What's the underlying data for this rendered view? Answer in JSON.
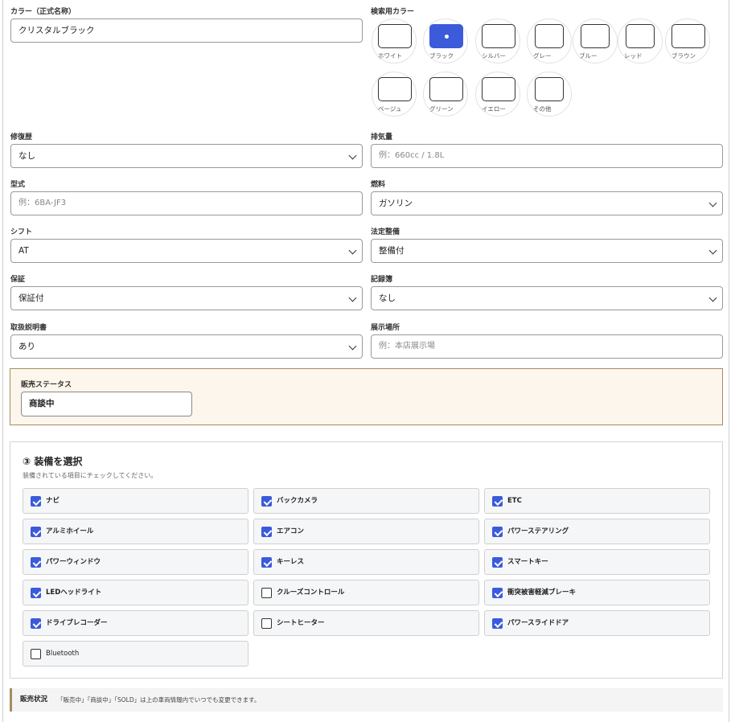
{
  "color_official": {
    "label": "カラー（正式名称）",
    "value": "クリスタルブラック"
  },
  "search_color": {
    "label": "検索用カラー",
    "options": [
      {
        "name": "ホワイト",
        "selected": false
      },
      {
        "name": "ブラック",
        "selected": true
      },
      {
        "name": "シルバー",
        "selected": false
      },
      {
        "name": "グレー",
        "selected": false
      },
      {
        "name": "ブルー",
        "selected": false
      },
      {
        "name": "レッド",
        "selected": false
      },
      {
        "name": "ブラウン",
        "selected": false
      },
      {
        "name": "ベージュ",
        "selected": false
      },
      {
        "name": "グリーン",
        "selected": false
      },
      {
        "name": "イエロー",
        "selected": false
      },
      {
        "name": "その他",
        "selected": false
      }
    ],
    "accent_color": "#3b5bdb"
  },
  "fields": {
    "repair_history": {
      "label": "修復歴",
      "value": "なし"
    },
    "displacement": {
      "label": "排気量",
      "placeholder": "例：660cc / 1.8L"
    },
    "model_code": {
      "label": "型式",
      "placeholder": "例：6BA-JF3"
    },
    "fuel": {
      "label": "燃料",
      "value": "ガソリン"
    },
    "shift": {
      "label": "シフト",
      "value": "AT"
    },
    "inspection": {
      "label": "法定整備",
      "value": "整備付"
    },
    "warranty": {
      "label": "保証",
      "value": "保証付"
    },
    "record_book": {
      "label": "記録簿",
      "value": "なし"
    },
    "manual": {
      "label": "取扱説明書",
      "value": "あり"
    },
    "showroom": {
      "label": "展示場所",
      "placeholder": "例：本店展示場"
    }
  },
  "sales_status": {
    "label": "販売ステータス",
    "value": "商談中",
    "panel_color": "#fdf6ec"
  },
  "equipment": {
    "title": "③ 装備を選択",
    "subtitle": "装備されている項目にチェックしてください。",
    "items": [
      {
        "label": "ナビ",
        "checked": true
      },
      {
        "label": "バックカメラ",
        "checked": true
      },
      {
        "label": "ETC",
        "checked": true
      },
      {
        "label": "アルミホイール",
        "checked": true
      },
      {
        "label": "エアコン",
        "checked": true
      },
      {
        "label": "パワーステアリング",
        "checked": true
      },
      {
        "label": "パワーウィンドウ",
        "checked": true
      },
      {
        "label": "キーレス",
        "checked": true
      },
      {
        "label": "スマートキー",
        "checked": true
      },
      {
        "label": "LEDヘッドライト",
        "checked": true
      },
      {
        "label": "クルーズコントロール",
        "checked": false
      },
      {
        "label": "衝突被害軽減ブレーキ",
        "checked": true
      },
      {
        "label": "ドライブレコーダー",
        "checked": true
      },
      {
        "label": "シートヒーター",
        "checked": false
      },
      {
        "label": "パワースライドドア",
        "checked": true
      },
      {
        "label": "Bluetooth",
        "checked": false
      }
    ]
  },
  "note": {
    "title": "販売状況",
    "text": "「販売中」「商談中」「SOLD」は上の車両情報内でいつでも変更できます。"
  }
}
